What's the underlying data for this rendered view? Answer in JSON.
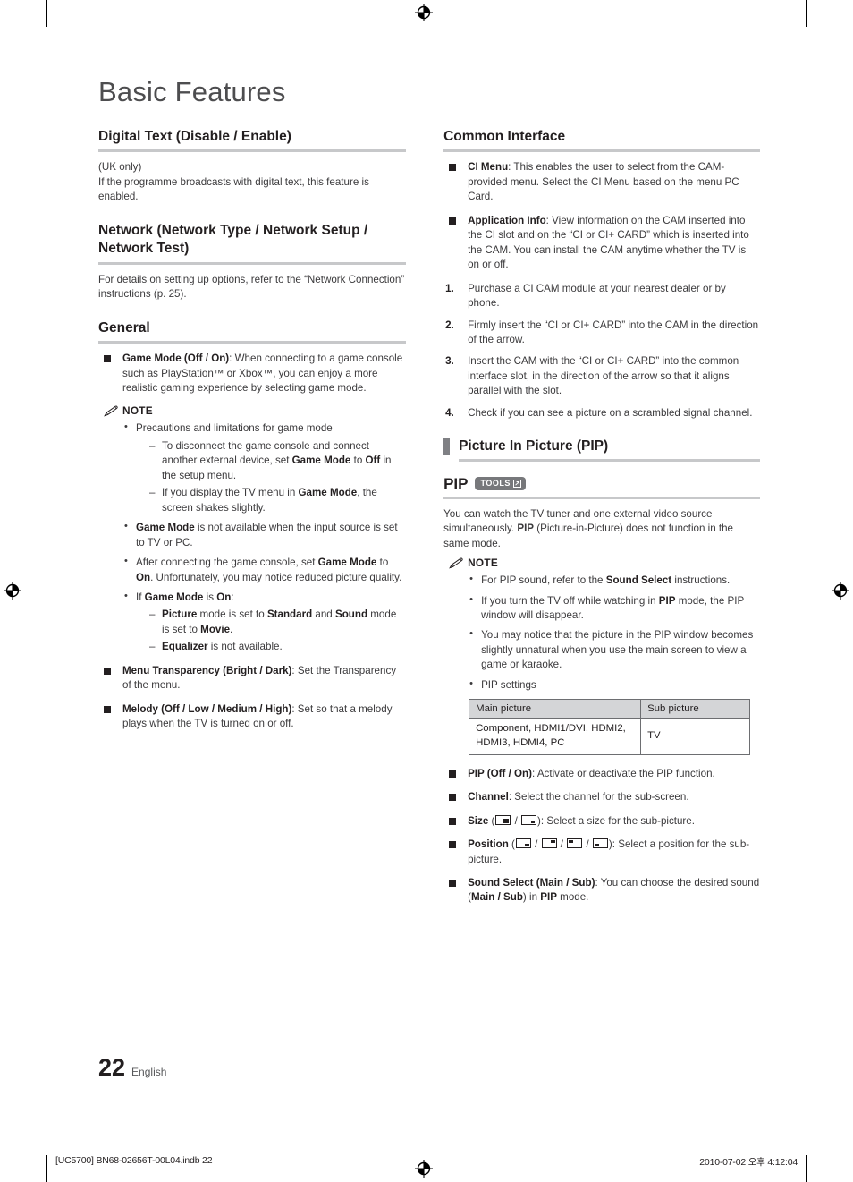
{
  "document": {
    "title": "Basic Features",
    "page_number": "22",
    "language_label": "English",
    "footer_file": "[UC5700] BN68-02656T-00L04.indb   22",
    "footer_stamp": "2010-07-02   오후 4:12:04"
  },
  "left_column": {
    "digital_text": {
      "heading": "Digital Text (Disable / Enable)",
      "line1": "(UK only)",
      "line2": "If the programme broadcasts with digital text, this feature is enabled."
    },
    "network": {
      "heading": "Network (Network Type / Network Setup / Network Test)",
      "body": "For details on setting up options, refer to the “Network Connection” instructions (p. 25)."
    },
    "general": {
      "heading": "General",
      "game_mode": {
        "term": "Game Mode (Off / On)",
        "desc": ": When connecting to a game console such as PlayStation™ or Xbox™, you can enjoy a more realistic gaming experience by selecting game mode."
      },
      "note_label": "NOTE",
      "note_items": {
        "i1": "Precautions and limitations for game mode",
        "i1_sub1_a": "To disconnect the game console and connect another external device, set ",
        "i1_sub1_b": "Game Mode",
        "i1_sub1_c": " to ",
        "i1_sub1_d": "Off",
        "i1_sub1_e": " in the setup menu.",
        "i1_sub2_a": "If you display the TV menu in ",
        "i1_sub2_b": "Game Mode",
        "i1_sub2_c": ", the screen shakes slightly.",
        "i2_a": "Game Mode",
        "i2_b": " is not available when the input source is set to TV or PC.",
        "i3_a": "After connecting the game console, set ",
        "i3_b": "Game Mode",
        "i3_c": " to ",
        "i3_d": "On",
        "i3_e": ". Unfortunately, you may notice reduced picture quality.",
        "i4_a": "If ",
        "i4_b": "Game Mode",
        "i4_c": " is ",
        "i4_d": "On",
        "i4_e": ":",
        "i4_sub1_a": "Picture",
        "i4_sub1_b": " mode is set to ",
        "i4_sub1_c": "Standard",
        "i4_sub1_d": " and ",
        "i4_sub1_e": "Sound",
        "i4_sub1_f": " mode is set to ",
        "i4_sub1_g": "Movie",
        "i4_sub1_h": ".",
        "i4_sub2_a": "Equalizer",
        "i4_sub2_b": " is not available."
      },
      "menu_transparency": {
        "term": "Menu Transparency (Bright / Dark)",
        "desc": ": Set the Transparency of the menu."
      },
      "melody": {
        "term": "Melody (Off / Low / Medium / High)",
        "desc": ": Set so that a melody plays when the TV is turned on or off."
      }
    }
  },
  "right_column": {
    "common_interface": {
      "heading": "Common Interface",
      "ci_menu": {
        "term": "CI Menu",
        "desc": ": This enables the user to select from the CAM-provided menu. Select the CI Menu based on the menu PC Card."
      },
      "application_info": {
        "term": "Application Info",
        "desc": ": View information on the CAM inserted into the CI slot and on the “CI or CI+ CARD” which is inserted into the CAM. You can install the CAM anytime whether the TV is on or off."
      },
      "steps": [
        "Purchase a CI CAM module at your nearest dealer or by phone.",
        "Firmly insert the “CI or CI+ CARD” into the CAM in the direction of the arrow.",
        "Insert the CAM with the “CI or CI+ CARD” into the common interface slot, in the direction of the arrow so that it aligns parallel with the slot.",
        "Check if you can see a picture on a scrambled signal channel."
      ]
    },
    "pip_section": {
      "bar_heading": "Picture In Picture (PIP)",
      "pip_title": "PIP",
      "tools_badge": "TOOLS",
      "intro_a": "You can watch the TV tuner and one external video source simultaneously. ",
      "intro_b": "PIP",
      "intro_c": " (Picture-in-Picture) does not function in the same mode.",
      "note_label": "NOTE",
      "note_items": {
        "n1_a": "For PIP sound, refer to the ",
        "n1_b": "Sound Select",
        "n1_c": " instructions.",
        "n2_a": "If you turn the TV off while watching in ",
        "n2_b": "PIP",
        "n2_c": " mode, the PIP window will disappear.",
        "n3": "You may notice that the picture in the PIP window becomes slightly unnatural when you use the main screen to view a game or karaoke.",
        "n4": "PIP settings"
      },
      "table": {
        "headers": [
          "Main picture",
          "Sub picture"
        ],
        "rows": [
          [
            "Component, HDMI1/DVI, HDMI2, HDMI3, HDMI4, PC",
            "TV"
          ]
        ]
      },
      "options": {
        "pip_onoff": {
          "term": "PIP (Off / On)",
          "desc": ": Activate or deactivate the PIP function."
        },
        "channel": {
          "term": "Channel",
          "desc": ": Select the channel for the sub-screen."
        },
        "size": {
          "term": "Size",
          "open": " (",
          "sep": " / ",
          "close": "): Select a size for the sub-picture."
        },
        "position": {
          "term": "Position",
          "open": " (",
          "sep": " / ",
          "close": "): Select a position for the sub-picture."
        },
        "sound_select": {
          "term": "Sound Select (Main / Sub)",
          "desc_a": ": You can choose the desired sound (",
          "desc_b": "Main / Sub",
          "desc_c": ") in ",
          "desc_d": "PIP",
          "desc_e": " mode."
        }
      }
    }
  },
  "colors": {
    "text": "#231f20",
    "body_text": "#3b3a3c",
    "rule": "#c7c8ca",
    "bar": "#7f8084",
    "badge": "#77787b",
    "table_header": "#d4d5d7"
  }
}
